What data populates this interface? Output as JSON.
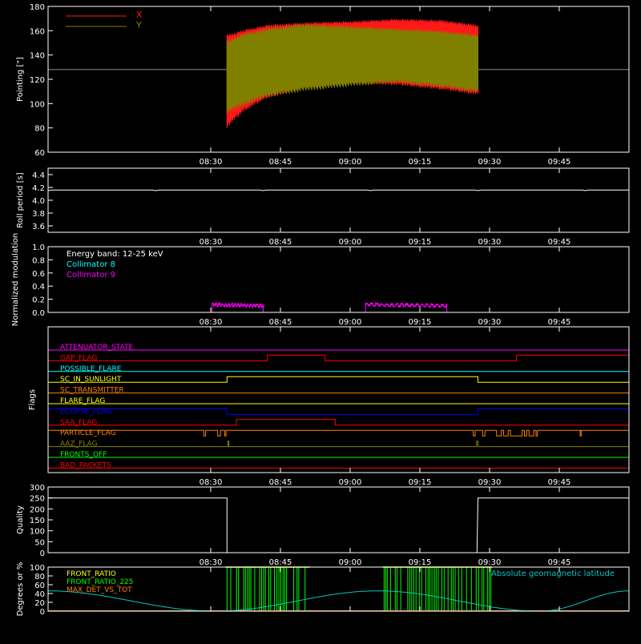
{
  "colors": {
    "bg": "#000000",
    "axis": "#ffffff",
    "x": "#ff1a1a",
    "y": "#808000",
    "roll": "#ffffff",
    "coll8": "#00ffff",
    "coll9": "#ff00ff",
    "quality": "#ffffff",
    "front_ratio": "#ffff00",
    "front_ratio_225": "#00ff00",
    "max_det": "#ff8000",
    "geomag": "#00c8c8"
  },
  "time_axis": {
    "range_minutes": [
      475,
      535
    ],
    "ticks": [
      {
        "t": 510,
        "label": "08:30"
      },
      {
        "t": 525,
        "label": "08:45"
      },
      {
        "t": 540,
        "label": "09:00"
      },
      {
        "t": 555,
        "label": "09:15"
      },
      {
        "t": 570,
        "label": "09:30"
      },
      {
        "t": 585,
        "label": "09:45"
      }
    ]
  },
  "chart_data": [
    {
      "type": "line",
      "ylabel": "Pointing [\"]",
      "ylim": [
        60,
        180
      ],
      "yticks": [
        60,
        80,
        100,
        120,
        140,
        160,
        180
      ],
      "legend": [
        "X",
        "Y"
      ],
      "reference_level": 128,
      "coverage": [
        513.5,
        567.5
      ],
      "series": [
        {
          "name": "X",
          "envelope": [
            {
              "t": 513.5,
              "lo": 80,
              "hi": 157
            },
            {
              "t": 517,
              "lo": 93,
              "hi": 161
            },
            {
              "t": 522,
              "lo": 104,
              "hi": 165
            },
            {
              "t": 530,
              "lo": 112,
              "hi": 167
            },
            {
              "t": 540,
              "lo": 116,
              "hi": 168
            },
            {
              "t": 550,
              "lo": 115,
              "hi": 170
            },
            {
              "t": 560,
              "lo": 111,
              "hi": 169
            },
            {
              "t": 567.5,
              "lo": 107,
              "hi": 165
            }
          ]
        },
        {
          "name": "Y",
          "envelope": [
            {
              "t": 513.5,
              "lo": 92,
              "hi": 152
            },
            {
              "t": 517,
              "lo": 98,
              "hi": 158
            },
            {
              "t": 522,
              "lo": 105,
              "hi": 162
            },
            {
              "t": 530,
              "lo": 110,
              "hi": 166
            },
            {
              "t": 540,
              "lo": 114,
              "hi": 164
            },
            {
              "t": 550,
              "lo": 117,
              "hi": 162
            },
            {
              "t": 560,
              "lo": 113,
              "hi": 160
            },
            {
              "t": 567.5,
              "lo": 109,
              "hi": 157
            }
          ]
        }
      ]
    },
    {
      "type": "line",
      "ylabel": "Roll period [s]",
      "ylim": [
        3.5,
        4.5
      ],
      "yticks": [
        3.6,
        3.8,
        4.0,
        4.2,
        4.4
      ],
      "ytick_labels": [
        "3.6",
        "3.8",
        "4.0",
        "4.2",
        "4.4"
      ],
      "series": [
        {
          "values": [
            {
              "t": 475,
              "v": 4.16
            },
            {
              "t": 600,
              "v": 4.16
            }
          ]
        }
      ]
    },
    {
      "type": "line",
      "ylabel": "Normalized modulation",
      "ylim": [
        0,
        1
      ],
      "yticks": [
        0,
        0.2,
        0.4,
        0.6,
        0.8,
        1.0
      ],
      "ytick_labels": [
        "0.0",
        "0.2",
        "0.4",
        "0.6",
        "0.8",
        "1.0"
      ],
      "annotations": [
        "Energy band: 12-25 keV",
        "Collimator 8",
        "Collimator 9"
      ],
      "series": [
        {
          "name": "Collimator 9",
          "active_intervals": [
            [
              510.3,
              521.3
            ],
            [
              543.3,
              560.8
            ]
          ],
          "level": 0.12
        },
        {
          "name": "Collimator 8",
          "level": 0.0
        }
      ]
    },
    {
      "type": "step",
      "ylabel": "Flags",
      "flags": [
        {
          "name": "ATTENUATOR_STATE",
          "color": "#ff00ff",
          "transitions": [],
          "initial": 0
        },
        {
          "name": "GAP_FLAG",
          "color": "#ff0000",
          "initial": 0,
          "transitions": [
            522.2,
            534.6,
            575.8
          ]
        },
        {
          "name": "POSSIBLE_FLARE",
          "color": "#00ffff",
          "initial": 0,
          "transitions": []
        },
        {
          "name": "SC_IN_SUNLIGHT",
          "color": "#ffff00",
          "initial": 0,
          "transitions": [
            513.5,
            567.5
          ]
        },
        {
          "name": "SC_TRANSMITTER",
          "color": "#ff8000",
          "initial": 0,
          "transitions": []
        },
        {
          "name": "FLARE_FLAG",
          "color": "#ffff00",
          "initial": 0,
          "transitions": []
        },
        {
          "name": "ECLIPSE_FLAG",
          "color": "#0000ff",
          "initial": 1,
          "transitions": [
            513.5,
            567.5
          ]
        },
        {
          "name": "SAA_FLAG",
          "color": "#ff0000",
          "initial": 0,
          "transitions": [
            515.5,
            536.8
          ]
        },
        {
          "name": "PARTICLE_FLAG",
          "color": "#ff8000",
          "initial": 1,
          "transitions": [
            508.5,
            508.9,
            511.5,
            512.1,
            513,
            513.3,
            566.5,
            566.9,
            568.5,
            569,
            571.5,
            572.5,
            573,
            574,
            574.5,
            577,
            577.5,
            578,
            578.5,
            579.5,
            580,
            580.3,
            589.5,
            589.7
          ]
        },
        {
          "name": "AAZ_FLAG",
          "color": "#808000",
          "initial": 0,
          "transitions": [
            513.7,
            513.9,
            567.2,
            567.5
          ]
        },
        {
          "name": "FRONTS_OFF",
          "color": "#00ff00",
          "initial": 0,
          "transitions": []
        },
        {
          "name": "BAD_PACKETS",
          "color": "#ff0000",
          "initial": 0,
          "transitions": []
        }
      ]
    },
    {
      "type": "step",
      "ylabel": "Quality",
      "ylim": [
        0,
        300
      ],
      "yticks": [
        0,
        50,
        100,
        150,
        200,
        250,
        300
      ],
      "series": [
        {
          "values": [
            {
              "t": 475,
              "v": 250
            },
            {
              "t": 513.5,
              "v": 250
            },
            {
              "t": 513.5,
              "v": 0
            },
            {
              "t": 567.3,
              "v": 0
            },
            {
              "t": 567.5,
              "v": 250
            },
            {
              "t": 600,
              "v": 250
            }
          ]
        }
      ]
    },
    {
      "type": "line",
      "ylabel": "Degrees or %",
      "ylim": [
        0,
        100
      ],
      "yticks": [
        0,
        20,
        40,
        60,
        80,
        100
      ],
      "legend": [
        "FRONT_RATIO",
        "FRONT_RATIO_225",
        "MAX_DET_VS_TOT"
      ],
      "right_label": "Absolute geomagnetic latitude",
      "front_ratio_225_intervals": [
        [
          513.2,
          531.3
        ],
        [
          547.0,
          570.5
        ]
      ],
      "geomag": {
        "min": 0,
        "max": 46,
        "peaks": [
          475,
          546,
          600
        ],
        "troughs": [
          511,
          581
        ]
      }
    }
  ]
}
